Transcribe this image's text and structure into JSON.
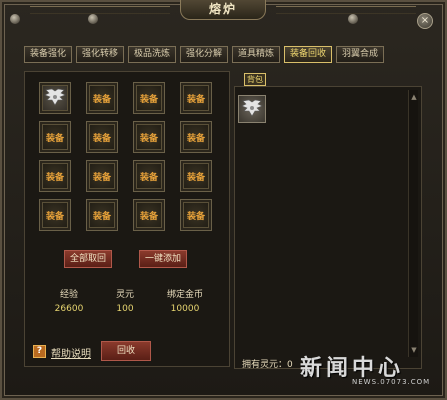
{
  "window": {
    "title": "熔炉",
    "close_label": "×"
  },
  "tabs": [
    {
      "label": "装备强化",
      "active": false
    },
    {
      "label": "强化转移",
      "active": false
    },
    {
      "label": "极品洗炼",
      "active": false
    },
    {
      "label": "强化分解",
      "active": false
    },
    {
      "label": "道具精炼",
      "active": false
    },
    {
      "label": "装备回收",
      "active": true
    },
    {
      "label": "羽翼合成",
      "active": false
    }
  ],
  "grid": {
    "slot_label": "装备",
    "first_slot_icon": "wing-icon"
  },
  "buttons": {
    "collect_all": "全部取回",
    "add_all": "一键添加",
    "recycle": "回收"
  },
  "stats": [
    {
      "label": "经验",
      "value": "26600"
    },
    {
      "label": "灵元",
      "value": "100"
    },
    {
      "label": "绑定金币",
      "value": "10000"
    }
  ],
  "help": {
    "icon_text": "?",
    "link": "帮助说明"
  },
  "bag": {
    "tab_label": "背包",
    "owned_label": "拥有灵元：0"
  },
  "watermark": {
    "big": "新闻中心",
    "small": "NEWS.07073.COM"
  },
  "colors": {
    "accent": "#f0d870",
    "button": "#8a3a2c",
    "slot_text": "#e9a33a"
  }
}
